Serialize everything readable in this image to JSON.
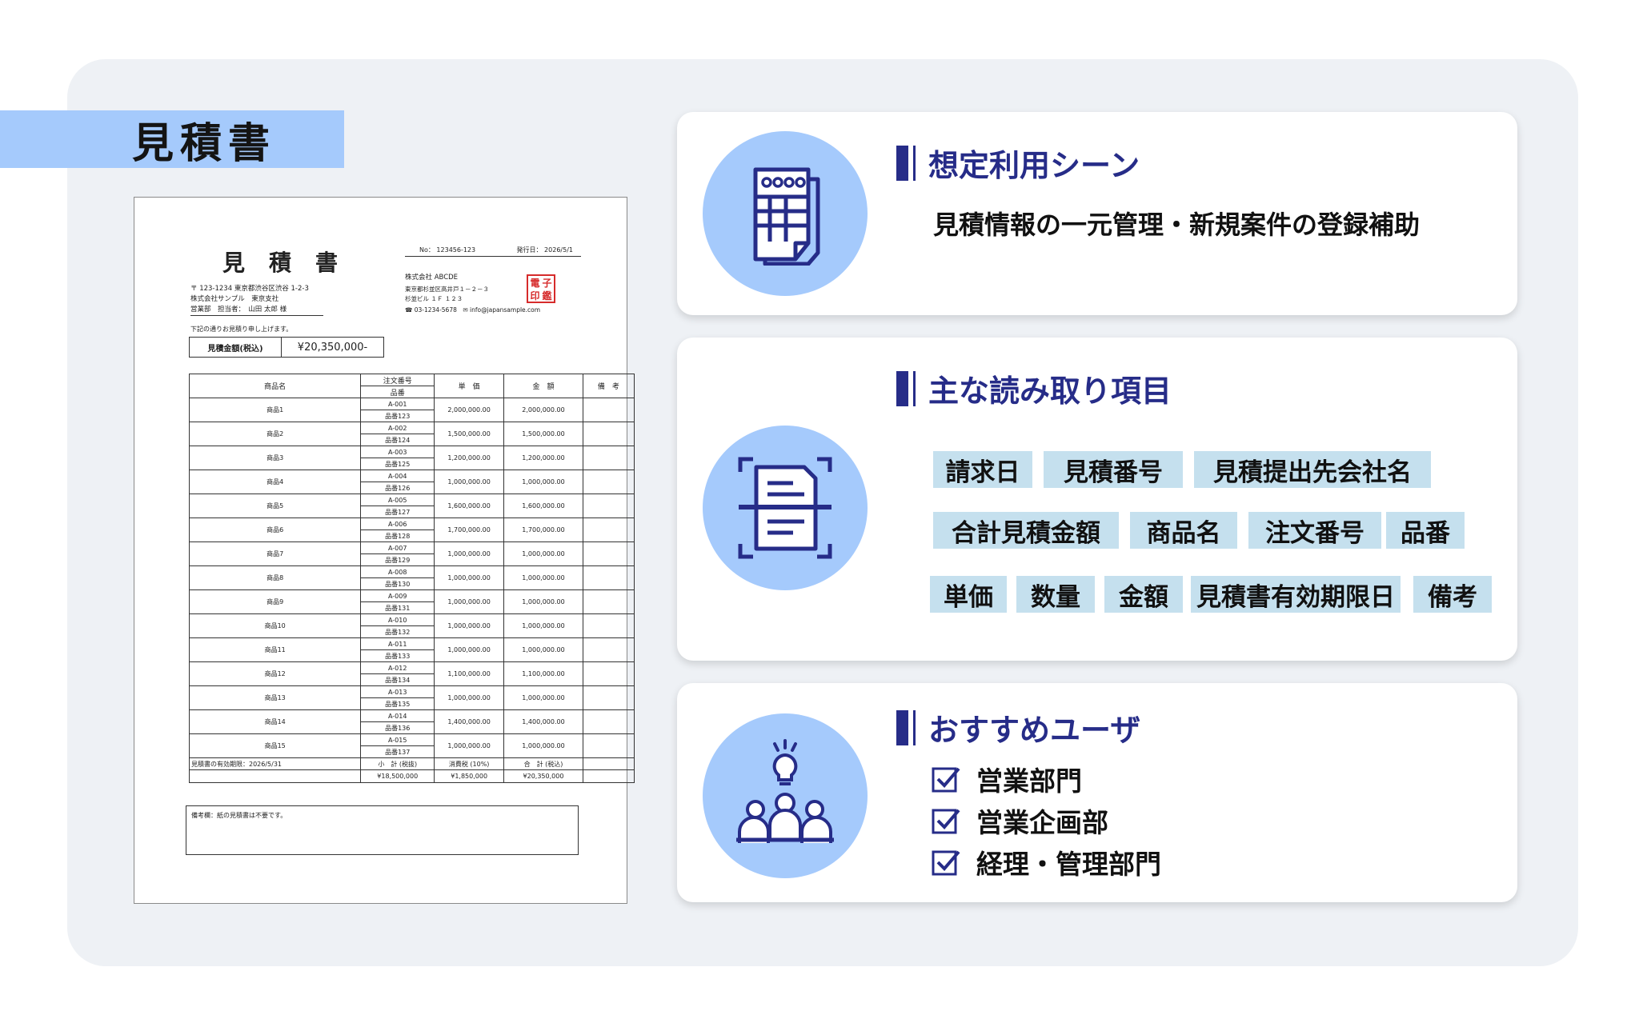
{
  "header": {
    "title": "見積書"
  },
  "document": {
    "title": "見積書",
    "no": "No： 123456-123",
    "issue_date": "発行日： 2026/5/1",
    "recipient": {
      "address": "〒 123-1234 東京都渋谷区渋谷 1-2-3",
      "company": "株式会社サンプル　東京支社",
      "contact": "営業部　担当者：　山田 太郎 様"
    },
    "issuer": {
      "company": "株式会社 ABCDE",
      "address1": "東京都杉並区高井戸１－２－３",
      "address2": "杉並ビル １Ｆ １２３",
      "contact": "☎ 03-1234-5678　✉ info@japansample.com"
    },
    "stamp": [
      "電",
      "子",
      "印",
      "鑑"
    ],
    "intro": "下記の通りお見積り申し上げます。",
    "total_label": "見積金額(税込)",
    "total_value": "¥20,350,000-",
    "columns": {
      "name": "商品名",
      "order_no": "注文番号",
      "part_no": "品番",
      "unit_price": "単　価",
      "amount": "金　額",
      "note": "備　考"
    },
    "rows": [
      {
        "name": "商品1",
        "order": "A-001",
        "part": "品番123",
        "price": "2,000,000.00",
        "amount": "2,000,000.00"
      },
      {
        "name": "商品2",
        "order": "A-002",
        "part": "品番124",
        "price": "1,500,000.00",
        "amount": "1,500,000.00"
      },
      {
        "name": "商品3",
        "order": "A-003",
        "part": "品番125",
        "price": "1,200,000.00",
        "amount": "1,200,000.00"
      },
      {
        "name": "商品4",
        "order": "A-004",
        "part": "品番126",
        "price": "1,000,000.00",
        "amount": "1,000,000.00"
      },
      {
        "name": "商品5",
        "order": "A-005",
        "part": "品番127",
        "price": "1,600,000.00",
        "amount": "1,600,000.00"
      },
      {
        "name": "商品6",
        "order": "A-006",
        "part": "品番128",
        "price": "1,700,000.00",
        "amount": "1,700,000.00"
      },
      {
        "name": "商品7",
        "order": "A-007",
        "part": "品番129",
        "price": "1,000,000.00",
        "amount": "1,000,000.00"
      },
      {
        "name": "商品8",
        "order": "A-008",
        "part": "品番130",
        "price": "1,000,000.00",
        "amount": "1,000,000.00"
      },
      {
        "name": "商品9",
        "order": "A-009",
        "part": "品番131",
        "price": "1,000,000.00",
        "amount": "1,000,000.00"
      },
      {
        "name": "商品10",
        "order": "A-010",
        "part": "品番132",
        "price": "1,000,000.00",
        "amount": "1,000,000.00"
      },
      {
        "name": "商品11",
        "order": "A-011",
        "part": "品番133",
        "price": "1,000,000.00",
        "amount": "1,000,000.00"
      },
      {
        "name": "商品12",
        "order": "A-012",
        "part": "品番134",
        "price": "1,100,000.00",
        "amount": "1,100,000.00"
      },
      {
        "name": "商品13",
        "order": "A-013",
        "part": "品番135",
        "price": "1,000,000.00",
        "amount": "1,000,000.00"
      },
      {
        "name": "商品14",
        "order": "A-014",
        "part": "品番136",
        "price": "1,400,000.00",
        "amount": "1,400,000.00"
      },
      {
        "name": "商品15",
        "order": "A-015",
        "part": "品番137",
        "price": "1,000,000.00",
        "amount": "1,000,000.00"
      }
    ],
    "footer": {
      "validity_label": "見積書の有効期限：",
      "validity_date": "2026/5/31",
      "subtotal_label": "小　計 (税抜)",
      "tax_label": "消費税",
      "tax_rate": "(10%)",
      "grand_label": "合　計 (税込)",
      "subtotal": "¥18,500,000",
      "tax": "¥1,850,000",
      "grand": "¥20,350,000"
    },
    "remarks": "備考欄：紙の見積書は不要です。"
  },
  "cards": {
    "scene": {
      "heading": "想定利用シーン",
      "description": "見積情報の一元管理・新規案件の登録補助",
      "icon": "invoice-document-icon"
    },
    "fields": {
      "heading": "主な読み取り項目",
      "icon": "scan-document-icon",
      "tags": [
        "請求日",
        "見積番号",
        "見積提出先会社名",
        "合計見積金額",
        "商品名",
        "注文番号",
        "品番",
        "単価",
        "数量",
        "金額",
        "見積書有効期限日",
        "備考"
      ]
    },
    "users": {
      "heading": "おすすめユーザ",
      "icon": "team-meeting-icon",
      "items": [
        "営業部門",
        "営業企画部",
        "経理・管理部門"
      ]
    }
  },
  "colors": {
    "accent_navy": "#262c88",
    "light_blue": "#a5cafc",
    "tag_bg": "#c5e0ee",
    "panel_bg": "#eef1f5"
  }
}
